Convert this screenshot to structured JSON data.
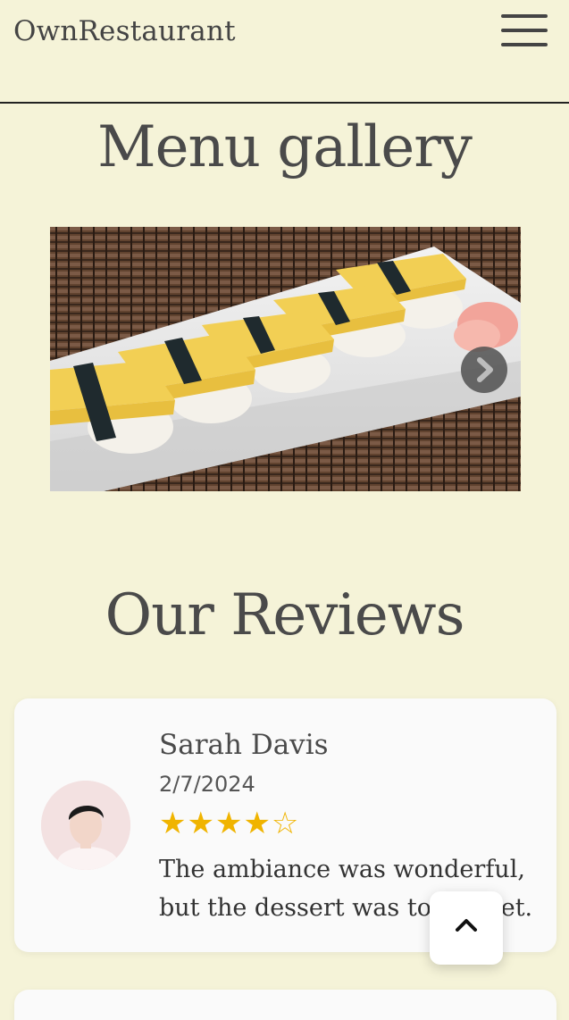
{
  "header": {
    "brand": "OwnRestaurant",
    "menu_icon": "hamburger-menu-icon"
  },
  "gallery": {
    "title": "Menu gallery",
    "image_alt": "Tamago sushi on a white plate",
    "next_icon": "chevron-right-icon"
  },
  "reviews": {
    "title": "Our Reviews",
    "items": [
      {
        "name": "Sarah Davis",
        "date": "2/7/2024",
        "rating": 4,
        "max_rating": 5,
        "stars": "★★★★☆",
        "text": "The ambiance was wonderful, but the dessert was too sweet."
      }
    ]
  },
  "scroll_top": {
    "icon": "chevron-up-icon"
  },
  "colors": {
    "background": "#f5f3d8",
    "card": "#fafafa",
    "star": "#f0b400",
    "text": "#4a4a4a"
  }
}
